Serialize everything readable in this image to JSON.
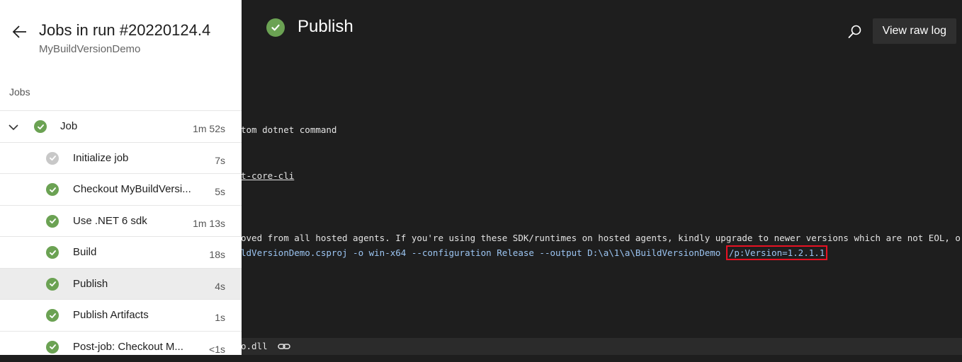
{
  "sidebar": {
    "title": "Jobs in run #20220124.4",
    "subtitle": "MyBuildVersionDemo",
    "section_label": "Jobs",
    "job": {
      "label": "Job",
      "duration": "1m 52s",
      "status": "succeeded"
    },
    "steps": [
      {
        "label": "Initialize job",
        "duration": "7s",
        "status": "skipped"
      },
      {
        "label": "Checkout MyBuildVersi...",
        "duration": "5s",
        "status": "succeeded"
      },
      {
        "label": "Use .NET 6 sdk",
        "duration": "1m 13s",
        "status": "succeeded"
      },
      {
        "label": "Build",
        "duration": "18s",
        "status": "succeeded"
      },
      {
        "label": "Publish",
        "duration": "4s",
        "status": "succeeded",
        "selected": true
      },
      {
        "label": "Publish Artifacts",
        "duration": "1s",
        "status": "succeeded"
      },
      {
        "label": "Post-job: Checkout M...",
        "duration": "<1s",
        "status": "succeeded"
      }
    ]
  },
  "log": {
    "title": "Publish",
    "view_raw_label": "View raw log",
    "lines": {
      "l1": "tom dotnet command",
      "l2": "t-core-cli",
      "l3": "oved from all hosted agents. If you're using these SDK/runtimes on hosted agents, kindly upgrade to newer versions which are not EOL, or else",
      "l4_cmd": "ldVersionDemo.csproj -o win-x64 --configuration Release --output D:\\a\\1\\a\\BuildVersionDemo ",
      "l4_highlight": "/p:Version=1.2.1.1"
    },
    "footer_text": "o.dll"
  },
  "colors": {
    "success": "#6ba253",
    "skipped": "#c8c8c8",
    "highlight_border": "#e81123",
    "log_bg": "#1e1e1e"
  },
  "icons": {
    "back": "arrow-left-icon",
    "search": "search-icon",
    "expand": "chevron-down-icon",
    "check": "check-icon",
    "link": "link-icon"
  }
}
